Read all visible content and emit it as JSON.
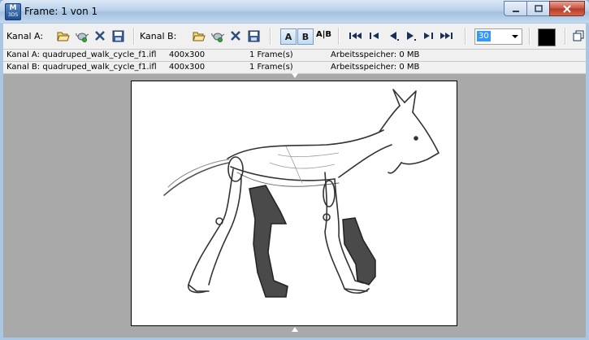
{
  "window": {
    "title": "Frame: 1 von 1",
    "app_icon_letter": "M",
    "app_icon_sub": "3DS",
    "controls": [
      "minimize",
      "maximize",
      "close"
    ]
  },
  "toolbar": {
    "channel_a_label": "Kanal A:",
    "channel_b_label": "Kanal B:",
    "toggle_a": "A",
    "toggle_b": "B",
    "split_label": "A|B",
    "frame_value": "30",
    "color_swatch": "#000000"
  },
  "info": {
    "channel_a": {
      "file": "Kanal A: quadruped_walk_cycle_f1.ifl",
      "resolution": "400x300",
      "frames": "1 Frame(s)",
      "memory": "Arbeitsspeicher: 0 MB"
    },
    "channel_b": {
      "file": "Kanal B: quadruped_walk_cycle_f1.ifl",
      "resolution": "400x300",
      "frames": "1 Frame(s)",
      "memory": "Arbeitsspeicher: 0 MB"
    }
  },
  "viewport": {
    "image": "sketch of a walking dog (quadruped walk cycle)",
    "width": 400,
    "height": 300
  }
}
